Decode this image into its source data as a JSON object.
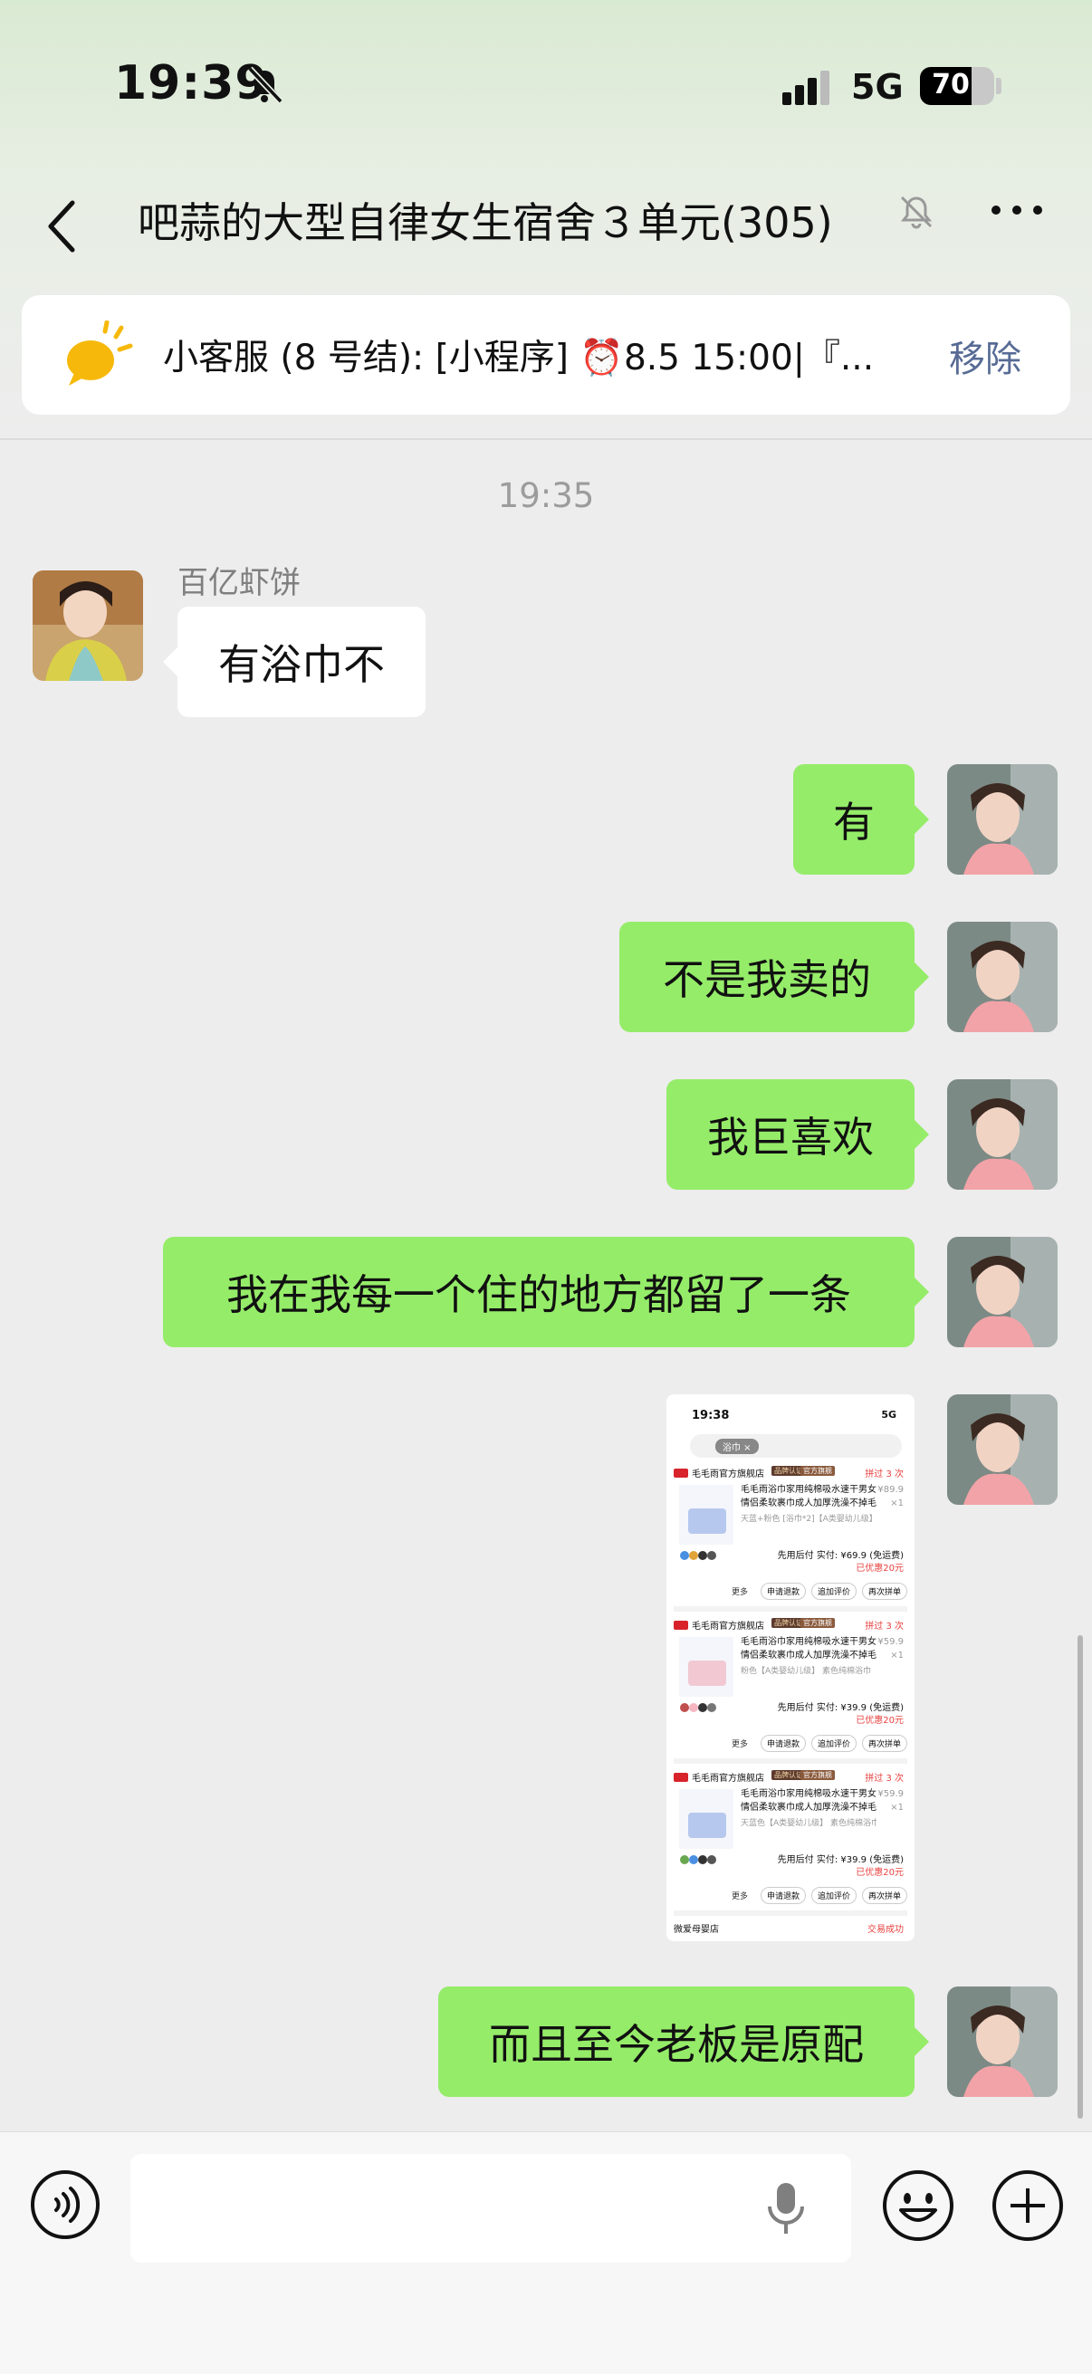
{
  "status_bar": {
    "time": "19:39",
    "network": "5G",
    "battery": "70",
    "battery_level": 0.7
  },
  "nav": {
    "title": "吧蒜的大型自律女生宿舍３单元(305)"
  },
  "notice": {
    "text": "小客服 (8 号结): [小程序] ⏰8.5 15:00|『...",
    "action": "移除"
  },
  "messages": [
    {
      "type": "timestamp",
      "text": "19:35"
    },
    {
      "sender": "百亿虾饼",
      "direction": "in",
      "text": "有浴巾不"
    },
    {
      "direction": "out",
      "text": "有"
    },
    {
      "direction": "out",
      "text": "不是我卖的"
    },
    {
      "direction": "out",
      "text": "我巨喜欢"
    },
    {
      "direction": "out",
      "text": "我在我每一个住的地方都留了一条"
    },
    {
      "direction": "out",
      "type": "image",
      "description": "order list screenshot"
    },
    {
      "direction": "out",
      "text": "而且至今老板是原配"
    }
  ],
  "shared_image": {
    "time": "19:38",
    "network": "5G",
    "search_chip": "浴巾 ×",
    "orders": [
      {
        "shop": "毛毛雨官方旗舰店",
        "tag1": "品牌认证",
        "tag2": "官方旗舰",
        "repurchase": "拼过 3 次",
        "title": "毛毛雨浴巾家用纯棉吸水速干男女情侣柔软裹巾成人加厚洗澡不掉毛",
        "spec": "天蓝+粉色 [浴巾*2]【A类婴幼儿级】",
        "price": "¥89.9",
        "qty": "×1",
        "paid": "先用后付 实付: ¥69.9 (免运费)",
        "saved": "已优惠20元",
        "buttons": [
          "更多",
          "申请退款",
          "追加评价",
          "再次拼单"
        ],
        "towel_color": "#b7c8ee"
      },
      {
        "shop": "毛毛雨官方旗舰店",
        "tag1": "品牌认证",
        "tag2": "官方旗舰",
        "repurchase": "拼过 3 次",
        "title": "毛毛雨浴巾家用纯棉吸水速干男女情侣柔软裹巾成人加厚洗澡不掉毛",
        "spec": "粉色【A类婴幼儿级】 素色纯棉浴巾",
        "price": "¥59.9",
        "qty": "×1",
        "paid": "先用后付 实付: ¥39.9 (免运费)",
        "saved": "已优惠20元",
        "buttons": [
          "更多",
          "申请退款",
          "追加评价",
          "再次拼单"
        ],
        "towel_color": "#f2c9d3"
      },
      {
        "shop": "毛毛雨官方旗舰店",
        "tag1": "品牌认证",
        "tag2": "官方旗舰",
        "repurchase": "拼过 3 次",
        "title": "毛毛雨浴巾家用纯棉吸水速干男女情侣柔软裹巾成人加厚洗澡不掉毛",
        "spec": "天蓝色【A类婴幼儿级】 素色纯棉浴巾",
        "price": "¥59.9",
        "qty": "×1",
        "paid": "先用后付 实付: ¥39.9 (免运费)",
        "saved": "已优惠20元",
        "buttons": [
          "更多",
          "申请退款",
          "追加评价",
          "再次拼单"
        ],
        "towel_color": "#b7c8ee"
      }
    ],
    "footer_shop": "微爱母婴店",
    "footer_status": "交易成功"
  },
  "colors": {
    "bubble_out": "#95ec69",
    "bubble_in": "#ffffff",
    "link": "#576b95",
    "accent": "#e64340"
  }
}
